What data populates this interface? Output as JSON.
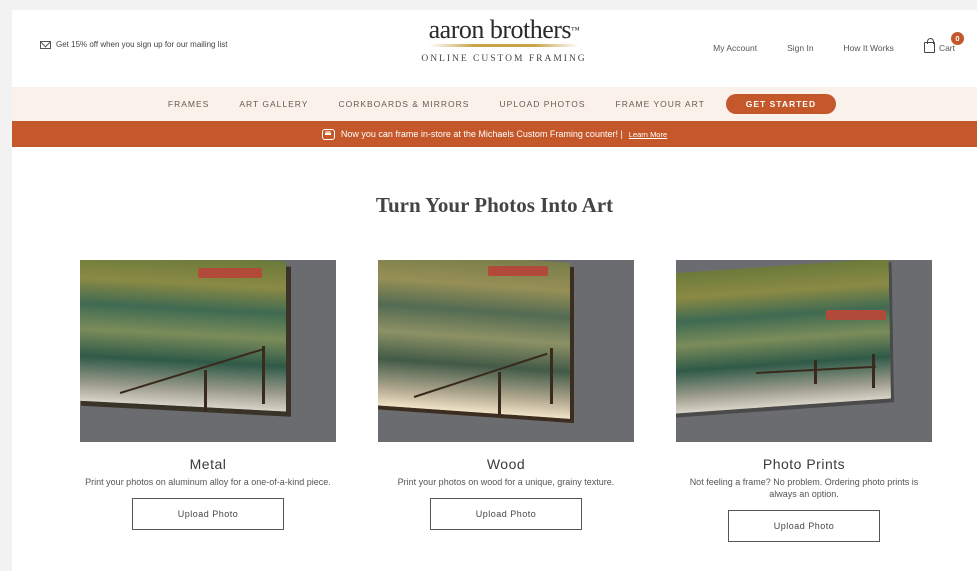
{
  "header": {
    "promo_text": "Get 15% off when you sign up for our mailing list",
    "logo_main": "aaron brothers",
    "logo_tm": "™",
    "logo_sub": "ONLINE CUSTOM FRAMING",
    "my_account": "My Account",
    "sign_in": "Sign In",
    "how_it_works": "How It Works",
    "cart_label": "Cart",
    "cart_count": "0"
  },
  "nav": {
    "items": [
      "FRAMES",
      "ART GALLERY",
      "CORKBOARDS & MIRRORS",
      "UPLOAD PHOTOS",
      "FRAME YOUR ART"
    ],
    "cta": "GET STARTED"
  },
  "notice": {
    "text": "Now you can frame in-store at the Michaels Custom Framing counter! |",
    "link": "Learn More"
  },
  "main": {
    "title": "Turn Your Photos Into Art",
    "cards": [
      {
        "title": "Metal",
        "desc": "Print your photos on aluminum alloy for a one-of-a-kind piece.",
        "button": "Upload Photo"
      },
      {
        "title": "Wood",
        "desc": "Print your photos on wood for a unique, grainy texture.",
        "button": "Upload Photo"
      },
      {
        "title": "Photo Prints",
        "desc": "Not feeling a frame? No problem. Ordering photo prints is always an option.",
        "button": "Upload Photo"
      }
    ]
  },
  "colors": {
    "accent": "#c4582b",
    "nav_bg": "#faf1ea",
    "card_bg": "#6b6c70"
  }
}
